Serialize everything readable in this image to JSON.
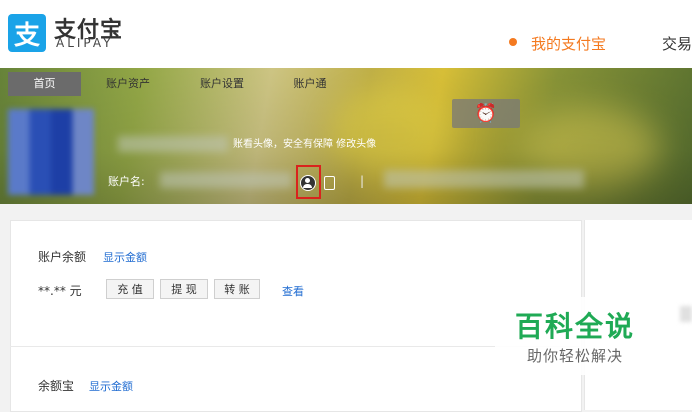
{
  "header": {
    "logo_glyph": "支",
    "logo_name_cn": "支付宝",
    "logo_name_en": "ALIPAY",
    "nav": [
      {
        "label": "我的支付宝",
        "active": true
      },
      {
        "label": "交易",
        "active": false
      }
    ]
  },
  "tabs": [
    "首页",
    "账户资产",
    "账户设置",
    "账户通"
  ],
  "profile": {
    "change_avatar_text": "账看头像，安全有保障 修改头像",
    "account_label": "账户名:",
    "separator": "|"
  },
  "balance": {
    "title": "账户余额",
    "show_amount": "显示金额",
    "value": "**.** 元",
    "buttons": [
      "充 值",
      "提 现",
      "转 账"
    ],
    "view": "查看"
  },
  "yuebao": {
    "title": "余额宝",
    "show_amount": "显示金额"
  },
  "watermark": {
    "title": "百科全说",
    "subtitle": "助你轻松解决"
  },
  "colors": {
    "brand_blue": "#1aa3e8",
    "accent_orange": "#f47a20",
    "link_blue": "#1f6bd1",
    "highlight_red": "#d9231d",
    "watermark_green": "#1faa55"
  }
}
